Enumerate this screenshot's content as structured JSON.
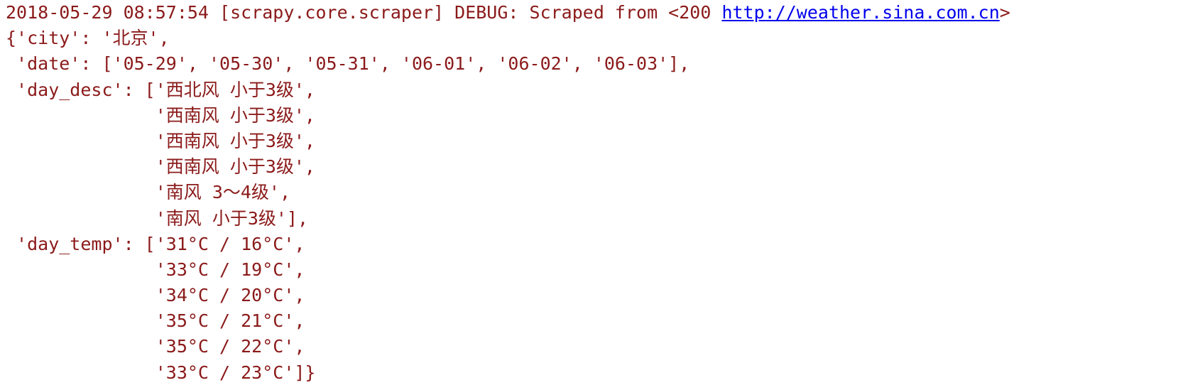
{
  "log": {
    "header": {
      "prefix": "2018-05-29 08:57:54 [scrapy.core.scraper] DEBUG: Scraped from <200 ",
      "url": "http://weather.sina.com.cn",
      "suffix": ">"
    },
    "lines": [
      "{'city': '北京',",
      " 'date': ['05-29', '05-30', '05-31', '06-01', '06-02', '06-03'],",
      " 'day_desc': ['西北风 小于3级',",
      "              '西南风 小于3级',",
      "              '西南风 小于3级',",
      "              '西南风 小于3级',",
      "              '南风 3～4级',",
      "              '南风 小于3级'],",
      " 'day_temp': ['31°C / 16°C',",
      "              '33°C / 19°C',",
      "              '34°C / 20°C',",
      "              '35°C / 21°C',",
      "              '35°C / 22°C',",
      "              '33°C / 23°C']}"
    ]
  },
  "colors": {
    "text": "#8b1a1a",
    "link": "#0000ee",
    "background": "#ffffff"
  }
}
